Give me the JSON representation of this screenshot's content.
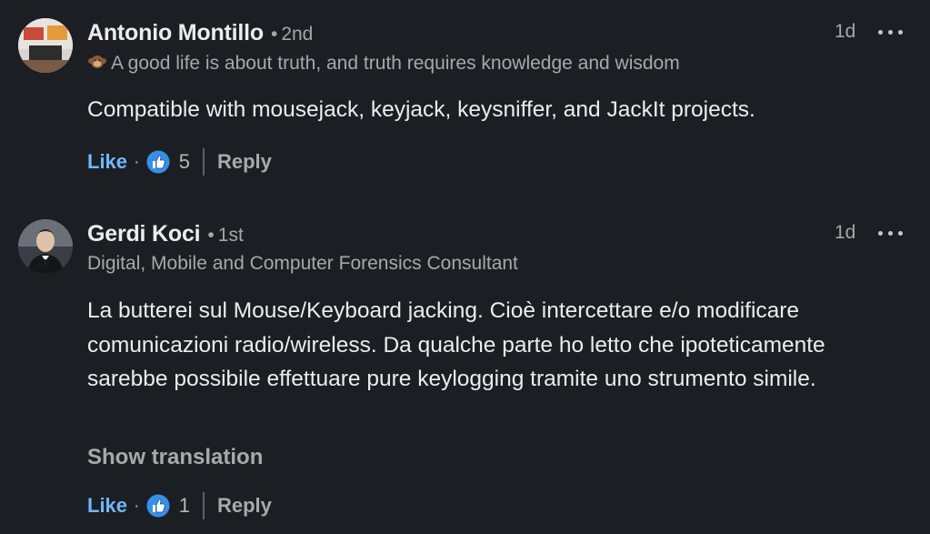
{
  "comments": [
    {
      "author": "Antonio Montillo",
      "separator": "•",
      "degree": "2nd",
      "headline_icon": "monkey-emoji-icon",
      "headline": "A good life is about truth, and truth requires knowledge and wisdom",
      "time": "1d",
      "text": "Compatible with mousejack, keyjack, keysniffer, and JackIt projects.",
      "like_label": "Like",
      "dot": "·",
      "reaction_icon": "thumbs-up-icon",
      "reactions": "5",
      "reply_label": "Reply"
    },
    {
      "author": "Gerdi Koci",
      "separator": "•",
      "degree": "1st",
      "headline": "Digital, Mobile and Computer Forensics Consultant",
      "time": "1d",
      "text": "La butterei sul Mouse/Keyboard jacking. Cioè intercettare e/o modificare comunicazioni radio/wireless. Da qualche parte ho letto che ipoteticamente sarebbe possibile effettuare pure keylogging tramite uno strumento simile.",
      "translation_label": "Show translation",
      "like_label": "Like",
      "dot": "·",
      "reaction_icon": "thumbs-up-icon",
      "reactions": "1",
      "reply_label": "Reply"
    }
  ],
  "colors": {
    "background": "#1b1f23",
    "like": "#71b7fb",
    "muted": "#a6a6a6",
    "reaction_blue": "#378fe9"
  }
}
